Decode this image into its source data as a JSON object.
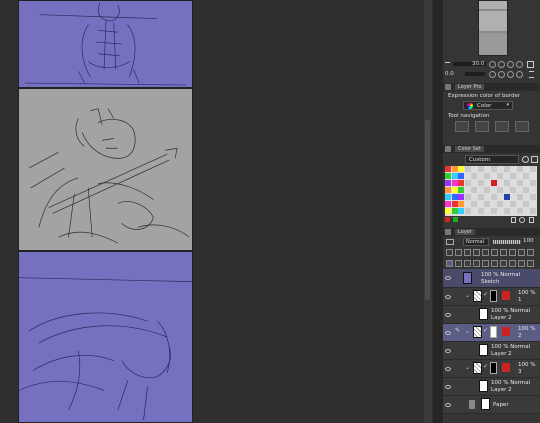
{
  "navigator": {
    "zoom_value": "30.0",
    "rotate_value": "0.0"
  },
  "layer_property": {
    "tab_label": "Layer Pro",
    "expression_label": "Expression color of border",
    "color_value": "Color",
    "tool_navigation_label": "Tool navigation"
  },
  "color_set": {
    "tab_label": "Color Set",
    "set_name": "Custom"
  },
  "layer_panel": {
    "tab_label": "Layer",
    "blend_mode": "Normal",
    "opacity": "100",
    "layers": [
      {
        "line1": "100 % Normal",
        "line2": "Sketch"
      },
      {
        "line1": "100 %",
        "line2": "1"
      },
      {
        "line1": "100 % Normal",
        "line2": "Layer 2"
      },
      {
        "line1": "100 %",
        "line2": "2"
      },
      {
        "line1": "100 % Normal",
        "line2": "Layer 2"
      },
      {
        "line1": "100 %",
        "line2": "3"
      },
      {
        "line1": "100 % Normal",
        "line2": "Layer 2"
      },
      {
        "line1": "Paper",
        "line2": ""
      }
    ]
  }
}
